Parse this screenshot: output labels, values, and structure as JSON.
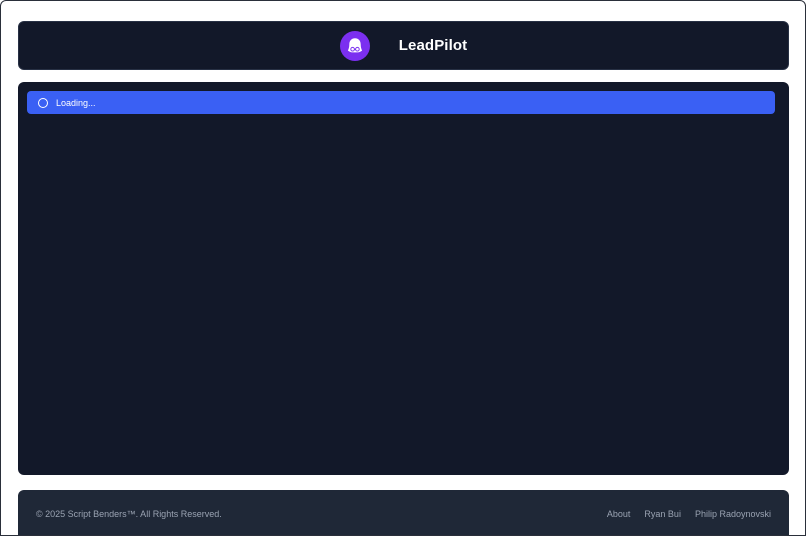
{
  "header": {
    "title": "LeadPilot",
    "logo_icon": "persona-glasses-icon",
    "logo_color": "#7b2ff0"
  },
  "main": {
    "loading_text": "Loading...",
    "loading_color": "#3a60f4",
    "spinner_icon": "spinner-icon"
  },
  "footer": {
    "copyright": "© 2025 Script Benders™. All Rights Reserved.",
    "links": [
      {
        "label": "About"
      },
      {
        "label": "Ryan Bui"
      },
      {
        "label": "Philip Radoynovski"
      }
    ]
  }
}
